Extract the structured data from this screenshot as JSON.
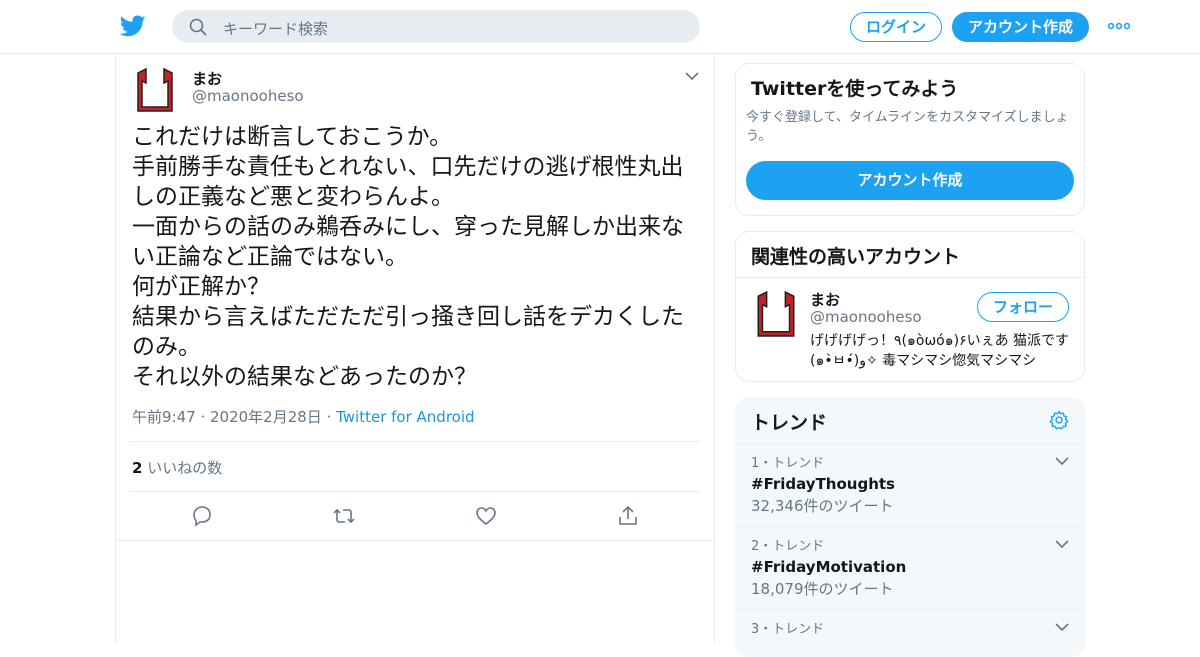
{
  "colors": {
    "accent": "#1da1f2",
    "text": "#14171a",
    "muted": "#657786",
    "border": "#e6ecf0"
  },
  "header": {
    "logo_icon": "twitter-bird-icon",
    "search_placeholder": "キーワード検索",
    "login_label": "ログイン",
    "signup_label": "アカウント作成",
    "more_icon": "more-dots-icon"
  },
  "tweet": {
    "display_name": "まお",
    "handle": "@maonooheso",
    "text": "これだけは断言しておこうか。\n手前勝手な責任もとれない、口先だけの逃げ根性丸出しの正義など悪と変わらんよ。\n一面からの話のみ鵜呑みにし、穿った見解しか出来ない正論など正論ではない。\n何が正解か？\n結果から言えばただただ引っ掻き回し話をデカくしたのみ。\nそれ以外の結果などあったのか？",
    "time": "午前9:47 · 2020年2月28日 · ",
    "source": "Twitter for Android",
    "like_count": "2",
    "like_label": " いいねの数",
    "actions": [
      "reply-icon",
      "retweet-icon",
      "like-icon",
      "share-icon"
    ]
  },
  "signup_card": {
    "title": "Twitterを使ってみよう",
    "description": "今すぐ登録して、タイムラインをカスタマイズしましょう。",
    "button": "アカウント作成"
  },
  "related_card": {
    "title": "関連性の高いアカウント",
    "name": "まお",
    "handle": "@maonooheso",
    "follow_label": "フォロー",
    "bio": "げげげげっ！٩(๑òωó๑)۶いぇあ 猫派です(๑•̀ㅂ•́)و✧ 毒マシマシ惚気マシマシ"
  },
  "trends_card": {
    "title": "トレンド",
    "items": [
      {
        "category": "1・トレンド",
        "name": "#FridayThoughts",
        "count": "32,346件のツイート"
      },
      {
        "category": "2・トレンド",
        "name": "#FridayMotivation",
        "count": "18,079件のツイート"
      },
      {
        "category": "3・トレンド",
        "name": "",
        "count": ""
      }
    ]
  }
}
